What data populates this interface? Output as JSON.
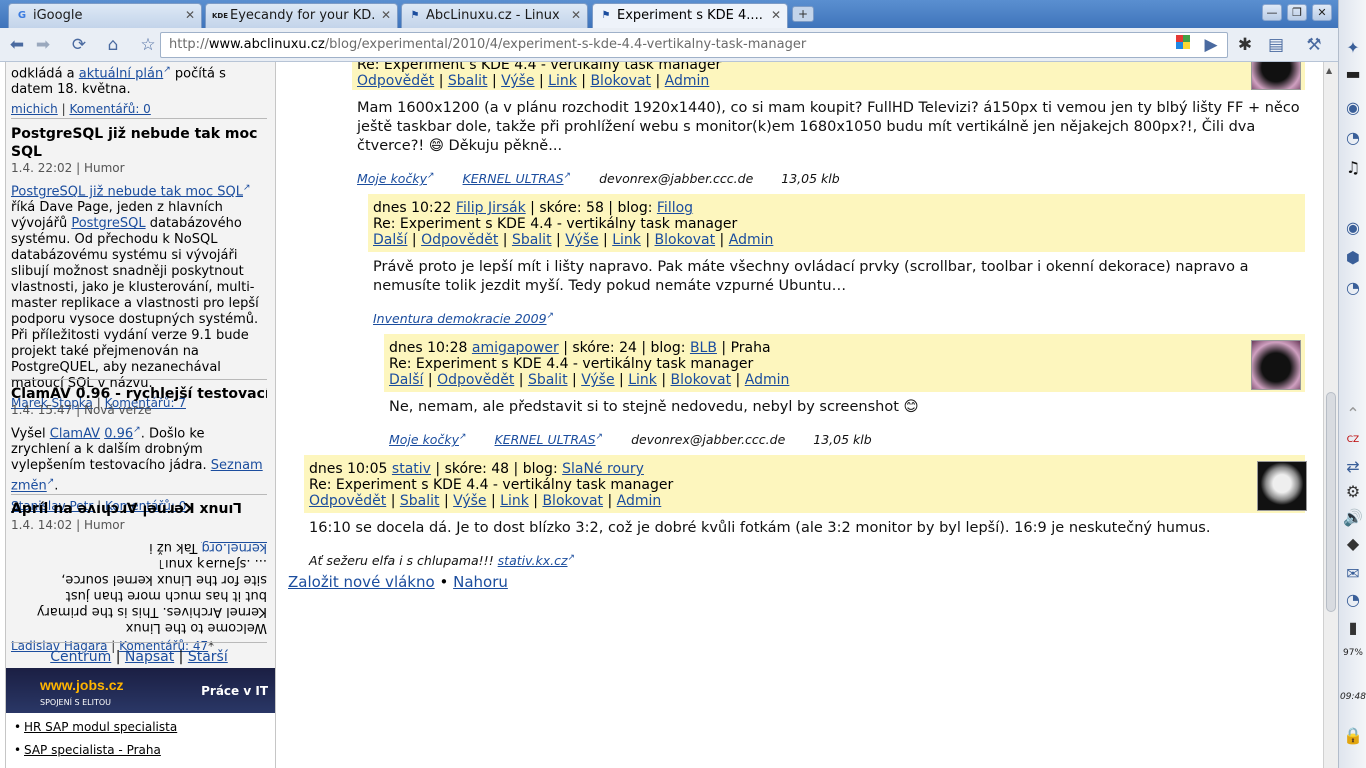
{
  "tabs": [
    {
      "label": "iGoogle",
      "favicon": "G",
      "color": "#3a7be0"
    },
    {
      "label": "Eyecandy for your KD...",
      "favicon": "KDE",
      "color": "#333333"
    },
    {
      "label": "AbcLinuxu.cz - Linux ...",
      "favicon": "⚑",
      "color": "#1b4d9e"
    },
    {
      "label": "Experiment s KDE 4....",
      "favicon": "⚑",
      "color": "#1b4d9e"
    }
  ],
  "toolbar": {
    "url_prefix": "http://",
    "url_domain": "www.abclinuxu.cz",
    "url_path": "/blog/experimental/2010/4/experiment-s-kde-4.4-vertikalny-task-manager"
  },
  "panel": {
    "battery": "97%",
    "clock": "09:48"
  },
  "sidebar": {
    "top_text": "odkládá a ",
    "top_link": "aktuální plán",
    "top_text2": " počítá s datem 18. května.",
    "top_author": "michich",
    "top_comments": "Komentářů: 0",
    "items": [
      {
        "title": "PostgreSQL již nebude tak moc SQL",
        "meta": "1.4. 22:02 | Humor",
        "link": "PostgreSQL již nebude tak moc SQL",
        "body": "říká Dave Page, jeden z hlavních vývojářů ",
        "body_link": "PostgreSQL",
        "body2": " databázového systému. Od přechodu k NoSQL databázovému systému si vývojáři slibují možnost snadněji poskytnout vlastnosti, jako je klusterování, multi-master replikace a vlastnosti pro lepší podporu vysoce dostupných systémů. Při příležitosti vydání verze 9.1 bude projekt také přejmenován na PostgreQUEL, aby nezanechával matoucí SQL v názvu.",
        "author": "Marek Stopka",
        "comments": "Komentářů: 7"
      },
      {
        "title": "ClamAV 0.96 - rychlejší testovací já...",
        "meta": "1.4. 15:47 | Nová verze",
        "body_pre": "Vyšel ",
        "link1": "ClamAV",
        "link2": "0.96",
        "body": ". Došlo ke zrychlení a k dalším drobným vylepšením testovacího jádra. ",
        "link3": "Seznam změn",
        "body_end": ".",
        "author": "Stanislav Petr",
        "comments": "Komentářů: 0"
      },
      {
        "title": "Linux Kernel Archives na ǝʌıɥɔɹ∀ ןǝuɹǝꓘ xnuıꓶ",
        "title_display": "Apríl na ǝʌıɥɔɹ∀ ןǝuɹǝꓘ xnuıꓶ",
        "meta": "1.4. 14:02 | Humor",
        "flip1": "Tak už i ",
        "flip_link": "kernel.org",
        "flip2": "... .sʃǝuɹǝʞ xnuı˥",
        "flip3": "site for the Linux kernel source,",
        "flip4": "but it has much more than just",
        "flip5": "Kernel Archives. This is the primary",
        "flip6": "Welcome to the Linux",
        "author": "Ladislav Hagara",
        "comments": "Komentářů: 47"
      }
    ],
    "nav": {
      "a": "Centrum",
      "b": "Napsat",
      "c": "Starší"
    },
    "jobs": {
      "logo": "www.jobs.cz",
      "slogan": "SPOJENÍ S ELITOU",
      "category": "Práce v IT",
      "list": [
        "HR SAP modul specialista",
        "SAP specialista - Praha"
      ]
    }
  },
  "comments": {
    "c0": {
      "subject": "Re: Experiment s KDE 4.4 - vertikálny task manager",
      "actions": [
        "Odpovědět",
        "Sbalit",
        "Výše",
        "Link",
        "Blokovat",
        "Admin"
      ],
      "body": "Mam 1600x1200 (a v plánu rozchodit 1920x1440), co si mam koupit? FullHD Televizi? á150px ti vemou jen ty blbý lišty FF + něco ještě taskbar dole, takže při prohlížení webu s monitor(k)em 1680x1050 budu mít vertikálně jen nějakejch 800px?!, Čili dva čtverce?! 😄 Děkuju pěkně...",
      "sig": [
        "Moje kočky",
        "KERNEL ULTRAS",
        "devonrex@jabber.ccc.de",
        "13,05 klb"
      ]
    },
    "c1": {
      "time": "dnes 10:22",
      "author": "Filip Jirsák",
      "score": "skóre: 58",
      "blog_label": "blog:",
      "blog": "Fillog",
      "subject": "Re: Experiment s KDE 4.4 - vertikálny task manager",
      "actions": [
        "Další",
        "Odpovědět",
        "Sbalit",
        "Výše",
        "Link",
        "Blokovat",
        "Admin"
      ],
      "body": "Právě proto je lepší mít i lišty napravo. Pak máte všechny ovládací prvky (scrollbar, toolbar i okenní dekorace) napravo a nemusíte tolik jezdit myší. Tedy pokud nemáte vzpurné Ubuntu…",
      "sig": "Inventura demokracie 2009"
    },
    "c2": {
      "time": "dnes 10:28",
      "author": "amigapower",
      "score": "skóre: 24",
      "blog_label": "blog:",
      "blog": "BLB",
      "location": "Praha",
      "subject": "Re: Experiment s KDE 4.4 - vertikálny task manager",
      "actions": [
        "Další",
        "Odpovědět",
        "Sbalit",
        "Výše",
        "Link",
        "Blokovat",
        "Admin"
      ],
      "body": "Ne, nemam, ale představit si to stejně nedovedu, nebyl by screenshot 😊",
      "sig": [
        "Moje kočky",
        "KERNEL ULTRAS",
        "devonrex@jabber.ccc.de",
        "13,05 klb"
      ]
    },
    "c3": {
      "time": "dnes 10:05",
      "author": "stativ",
      "score": "skóre: 48",
      "blog_label": "blog:",
      "blog": "SlaNé roury",
      "subject": "Re: Experiment s KDE 4.4 - vertikálny task manager",
      "actions": [
        "Odpovědět",
        "Sbalit",
        "Výše",
        "Link",
        "Blokovat",
        "Admin"
      ],
      "body": "16:10 se docela dá. Je to dost blízko 3:2, což je dobré kvůli fotkám (ale 3:2 monitor by byl lepší). 16:9 je neskutečný humus.",
      "sig_text": "Ať sežeru elfa i s chlupama!!! ",
      "sig_link": "stativ.kx.cz"
    }
  },
  "bottom_nav": {
    "new_thread": "Založit nové vlákno",
    "sep": "•",
    "top": "Nahoru"
  }
}
